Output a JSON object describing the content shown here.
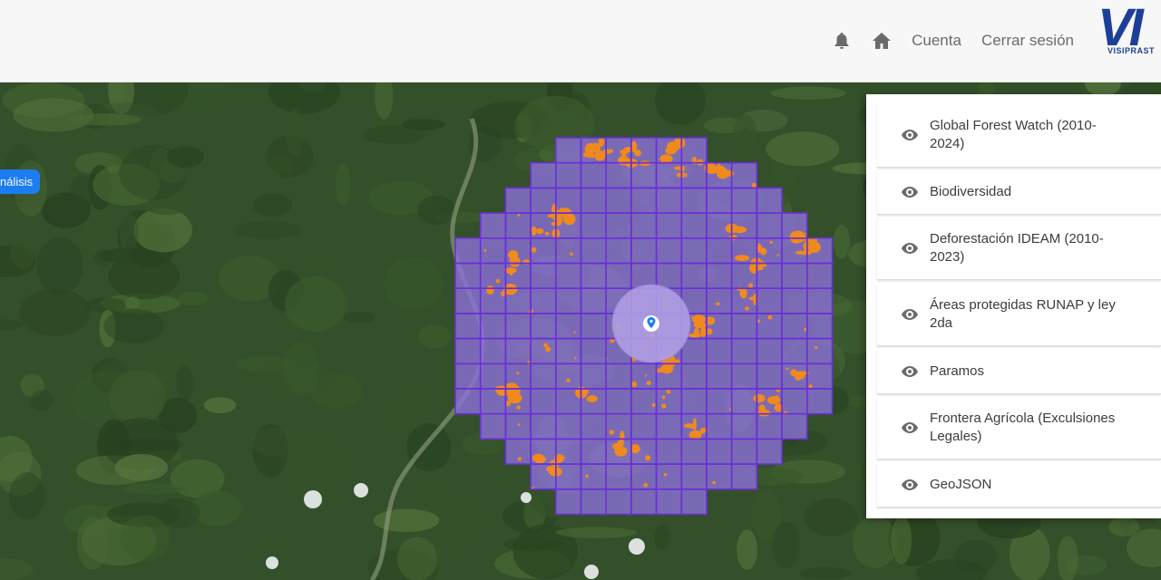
{
  "header": {
    "notifications_icon": "bell-icon",
    "home_icon": "home-icon",
    "account_label": "Cuenta",
    "logout_label": "Cerrar sesión",
    "logo_text": "VI",
    "logo_subtext": "VISIPRAST"
  },
  "map": {
    "analysis_button_label": "nálisis",
    "grid_color": "#6a2fd8",
    "grid_fill": "#8a70d6",
    "loss_color": "#f08a1c",
    "marker_icon": "location-pin-icon"
  },
  "layers_panel": {
    "items": [
      {
        "label": "Global Forest Watch (2010-2024)",
        "icon": "eye-icon"
      },
      {
        "label": "Biodiversidad",
        "icon": "eye-icon"
      },
      {
        "label": "Deforestación IDEAM (2010-2023)",
        "icon": "eye-icon"
      },
      {
        "label": "Áreas protegidas RUNAP y ley 2da",
        "icon": "eye-icon"
      },
      {
        "label": "Paramos",
        "icon": "eye-icon"
      },
      {
        "label": "Frontera Agrícola (Exculsiones Legales)",
        "icon": "eye-icon"
      },
      {
        "label": "GeoJSON",
        "icon": "eye-icon"
      }
    ]
  }
}
